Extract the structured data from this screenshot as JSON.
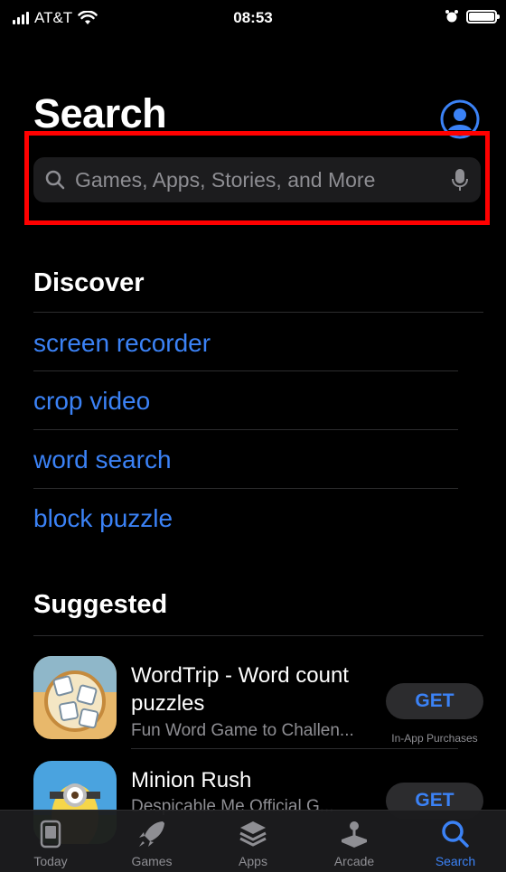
{
  "status_bar": {
    "carrier": "AT&T",
    "time": "08:53"
  },
  "header": {
    "title": "Search"
  },
  "search": {
    "placeholder": "Games, Apps, Stories, and More"
  },
  "discover": {
    "title": "Discover",
    "items": [
      {
        "label": "screen recorder"
      },
      {
        "label": "crop video"
      },
      {
        "label": "word search"
      },
      {
        "label": "block puzzle"
      }
    ]
  },
  "suggested": {
    "title": "Suggested",
    "apps": [
      {
        "name": "WordTrip - Word count puzzles",
        "subtitle": "Fun Word Game to Challen...",
        "button": "GET",
        "note": "In-App Purchases"
      },
      {
        "name": "Minion Rush",
        "subtitle": "Despicable Me Official G...",
        "button": "GET",
        "note": ""
      }
    ]
  },
  "tab_bar": {
    "tabs": [
      {
        "label": "Today",
        "icon": "today-icon"
      },
      {
        "label": "Games",
        "icon": "rocket-icon"
      },
      {
        "label": "Apps",
        "icon": "layers-icon"
      },
      {
        "label": "Arcade",
        "icon": "joystick-icon"
      },
      {
        "label": "Search",
        "icon": "search-icon",
        "active": true
      }
    ]
  },
  "colors": {
    "accent": "#3b82f6",
    "highlight": "#ff0000",
    "background": "#000000"
  }
}
